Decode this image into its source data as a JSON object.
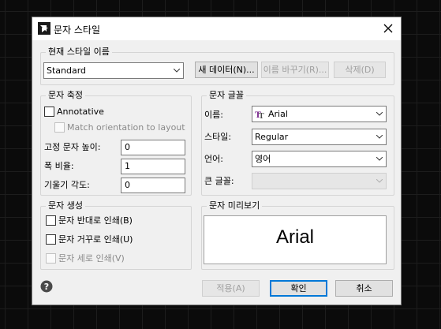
{
  "dialog": {
    "title": "문자 스타일",
    "app_icon": "app-logo-icon",
    "close_icon": "close-icon"
  },
  "style_name": {
    "group_label": "현재 스타일 이름",
    "selected": "Standard",
    "new_button": "새 데이터(N)...",
    "rename_button": "이름 바꾸기(R)...",
    "delete_button": "삭제(D)"
  },
  "size": {
    "group_label": "문자 축정",
    "annotative_label": "Annotative",
    "match_orientation_label": "Match orientation to layout",
    "height_label": "고정 문자 높이:",
    "height_value": "0",
    "width_label": "폭 비율:",
    "width_value": "1",
    "oblique_label": "기울기 각도:",
    "oblique_value": "0"
  },
  "font": {
    "group_label": "문자 글꼴",
    "name_label": "이름:",
    "name_value": "Arial",
    "name_icon": "truetype-font-icon",
    "style_label": "스타일:",
    "style_value": "Regular",
    "language_label": "언어:",
    "language_value": "영어",
    "bigfont_label": "큰 글꼴:",
    "bigfont_value": ""
  },
  "generation": {
    "group_label": "문자 생성",
    "backwards_label": "문자 반대로 인쇄(B)",
    "upside_down_label": "문자 거꾸로 인쇄(U)",
    "vertical_label": "문자 세로 인쇄(V)"
  },
  "preview": {
    "group_label": "문자 미리보기",
    "text": "Arial"
  },
  "footer": {
    "help_icon": "help-icon",
    "apply_button": "적용(A)",
    "ok_button": "확인",
    "cancel_button": "취소"
  },
  "colors": {
    "font_icon_color": "#7b2b8f",
    "accent": "#0078d7"
  }
}
